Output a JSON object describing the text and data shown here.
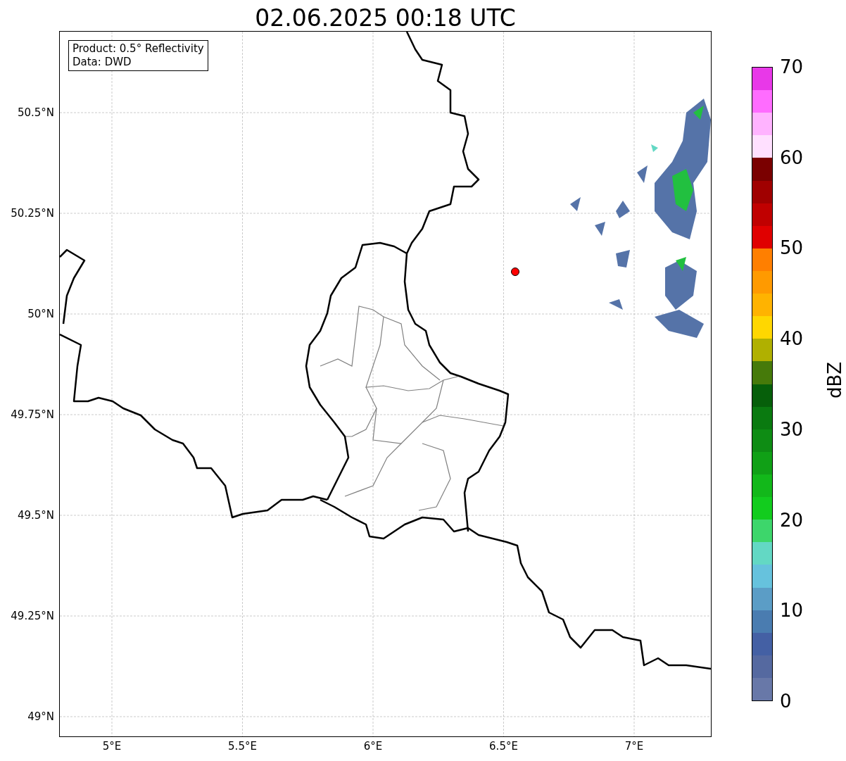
{
  "title": "02.06.2025 00:18 UTC",
  "info_box": {
    "lines": [
      "Product: 0.5° Reflectivity",
      "Data: DWD"
    ]
  },
  "map": {
    "lat_ticks": [
      "50.5°N",
      "50.25°N",
      "50°N",
      "49.75°N",
      "49.5°N",
      "49.25°N",
      "49°N"
    ],
    "lon_ticks": [
      "5°E",
      "5.5°E",
      "6°E",
      "6.5°E",
      "7°E"
    ]
  },
  "colorbar": {
    "label": "dBZ",
    "ticks": [
      "70",
      "60",
      "50",
      "40",
      "30",
      "20",
      "10",
      "0"
    ],
    "bands": [
      {
        "color": "#6878a8"
      },
      {
        "color": "#5569a0"
      },
      {
        "color": "#4460a4"
      },
      {
        "color": "#4a7cb0"
      },
      {
        "color": "#5b9dc6"
      },
      {
        "color": "#66c2dd"
      },
      {
        "color": "#63d8c4"
      },
      {
        "color": "#3dd66b"
      },
      {
        "color": "#12cc1e"
      },
      {
        "color": "#12b81a"
      },
      {
        "color": "#10a016"
      },
      {
        "color": "#0e8c14"
      },
      {
        "color": "#0a7a10"
      },
      {
        "color": "#065f0a"
      },
      {
        "color": "#467a0a"
      },
      {
        "color": "#b0b000"
      },
      {
        "color": "#ffd700"
      },
      {
        "color": "#ffb300"
      },
      {
        "color": "#ff9a00"
      },
      {
        "color": "#ff7f00"
      },
      {
        "color": "#e00000"
      },
      {
        "color": "#c00000"
      },
      {
        "color": "#a00000"
      },
      {
        "color": "#7a0000"
      },
      {
        "color": "#ffe0ff"
      },
      {
        "color": "#ffb3ff"
      },
      {
        "color": "#ff6cff"
      },
      {
        "color": "#e838e8"
      }
    ]
  }
}
